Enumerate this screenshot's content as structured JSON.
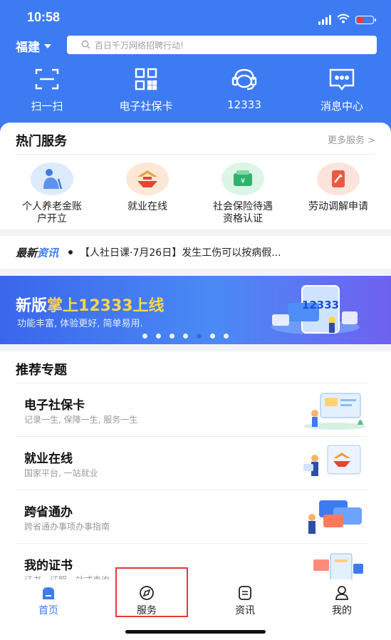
{
  "status": {
    "time": "10:58"
  },
  "header": {
    "region": "福建",
    "search_placeholder": "百日千万网络招聘行动!",
    "quick_actions": [
      {
        "label": "扫一扫",
        "icon": "scan-icon"
      },
      {
        "label": "电子社保卡",
        "icon": "qr-code-icon"
      },
      {
        "label": "12333",
        "icon": "headset-icon"
      },
      {
        "label": "消息中心",
        "icon": "message-icon"
      }
    ]
  },
  "hot_services": {
    "title": "热门服务",
    "more": "更多服务 >",
    "items": [
      {
        "label": "个人养老金账\n户开立",
        "icon": "elderly-icon",
        "color": "#dceafc"
      },
      {
        "label": "就业在线",
        "icon": "employment-icon",
        "color": "#fde7d7"
      },
      {
        "label": "社会保险待遇\n资格认证",
        "icon": "wallet-icon",
        "color": "#dcf5e6"
      },
      {
        "label": "劳动调解申请",
        "icon": "document-icon",
        "color": "#fde3dc"
      }
    ]
  },
  "news": {
    "tag_part1": "最新",
    "tag_part2": "资讯",
    "text": "【人社日课·7月26日】发生工伤可以按病假..."
  },
  "banner": {
    "title_part1": "新版",
    "title_part2": "掌上12333上线",
    "subtitle": "功能丰富, 体验更好, 简单易用.",
    "image_text": "12333"
  },
  "recommend": {
    "title": "推荐专题",
    "items": [
      {
        "name": "电子社保卡",
        "desc": "记录一生, 保障一生, 服务一生",
        "icon": "social-card-illustration"
      },
      {
        "name": "就业在线",
        "desc": "国家平台, 一站就业",
        "icon": "employment-illustration"
      },
      {
        "name": "跨省通办",
        "desc": "跨省通办事项办事指南",
        "icon": "cards-illustration"
      },
      {
        "name": "我的证书",
        "desc": "证书、证照一站式查询",
        "icon": "certificate-illustration"
      }
    ]
  },
  "tabs": [
    {
      "label": "首页",
      "icon": "home-icon",
      "active": true
    },
    {
      "label": "服务",
      "icon": "compass-icon",
      "active": false
    },
    {
      "label": "资讯",
      "icon": "news-icon",
      "active": false
    },
    {
      "label": "我的",
      "icon": "profile-icon",
      "active": false
    }
  ],
  "colors": {
    "brand": "#3d7bf2",
    "highlight": "#e53935"
  }
}
